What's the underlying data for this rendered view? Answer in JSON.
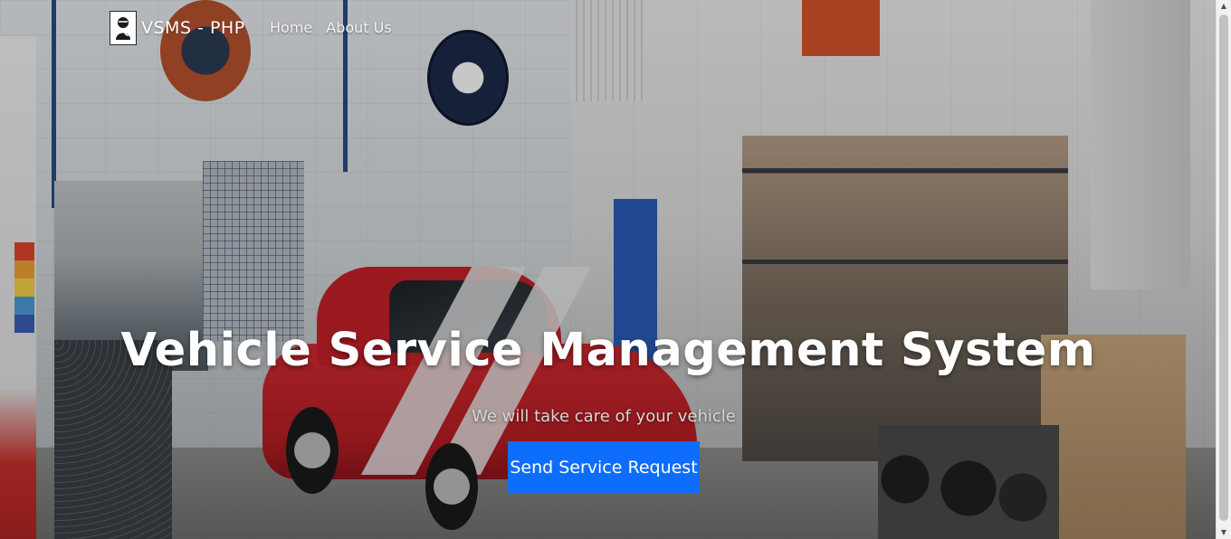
{
  "navbar": {
    "brand_text": "VSMS - PHP",
    "brand_logo_icon": "mechanic-logo-icon",
    "links": [
      {
        "label": "Home"
      },
      {
        "label": "About Us"
      }
    ]
  },
  "hero": {
    "title": "Vehicle Service Management System",
    "subtitle": "We will take care of your vehicle",
    "cta_label": "Send Service Request",
    "cta_color": "#0d6efd"
  },
  "scrollbar": {
    "up_icon": "scroll-up-icon",
    "down_icon": "scroll-down-icon"
  }
}
